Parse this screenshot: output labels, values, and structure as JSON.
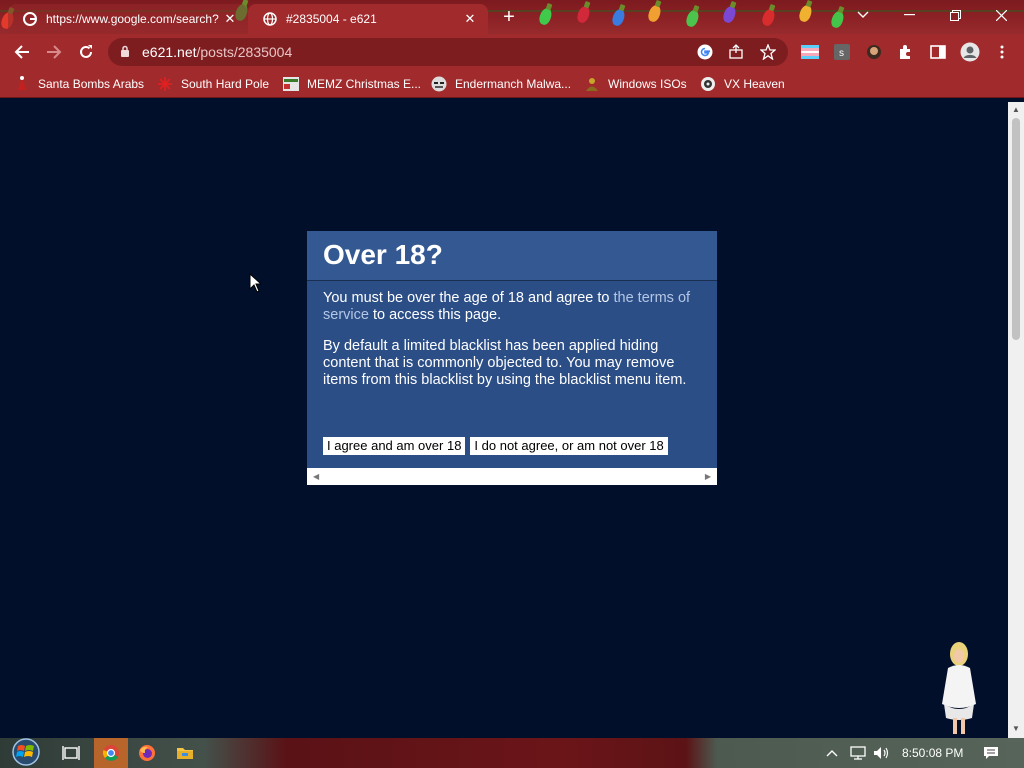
{
  "browser": {
    "tabs": [
      {
        "title": "https://www.google.com/search?",
        "favicon": "google-icon",
        "active": false
      },
      {
        "title": "#2835004 - e621",
        "favicon": "globe-icon",
        "active": true
      }
    ],
    "address_host": "e621.net",
    "address_path": "/posts/2835004",
    "theme_colors": {
      "frame": "#8d2226",
      "toolbar": "#a12a2c",
      "omnibox": "#7e1d20"
    }
  },
  "bookmarks": [
    {
      "label": "Santa Bombs Arabs",
      "icon": "santa-icon"
    },
    {
      "label": "South Hard Pole",
      "icon": "snowflake-icon"
    },
    {
      "label": "MEMZ Christmas E...",
      "icon": "memz-icon"
    },
    {
      "label": "Endermanch Malwa...",
      "icon": "enderman-icon"
    },
    {
      "label": "Windows ISOs",
      "icon": "windows-isos-icon"
    },
    {
      "label": "VX Heaven",
      "icon": "vx-heaven-icon"
    }
  ],
  "dialog": {
    "title": "Over 18?",
    "para1_before": "You must be over the age of 18 and agree to ",
    "para1_link": "the terms of service",
    "para1_after": " to access this page.",
    "para2": "By default a limited blacklist has been applied hiding content that is commonly objected to. You may remove items from this blacklist by using the blacklist menu item.",
    "agree_button": "I agree and am over 18",
    "disagree_button": "I do not agree, or am not over 18"
  },
  "taskbar": {
    "clock": "8:50:08 PM",
    "apps": [
      "start-orb-icon",
      "task-view-icon",
      "chrome-icon",
      "firefox-icon",
      "file-explorer-icon"
    ]
  },
  "colors": {
    "page_bg": "#020f2b",
    "dialog_bg": "#2c4e86",
    "dialog_head": "#335892",
    "link": "#b4c6e6"
  }
}
